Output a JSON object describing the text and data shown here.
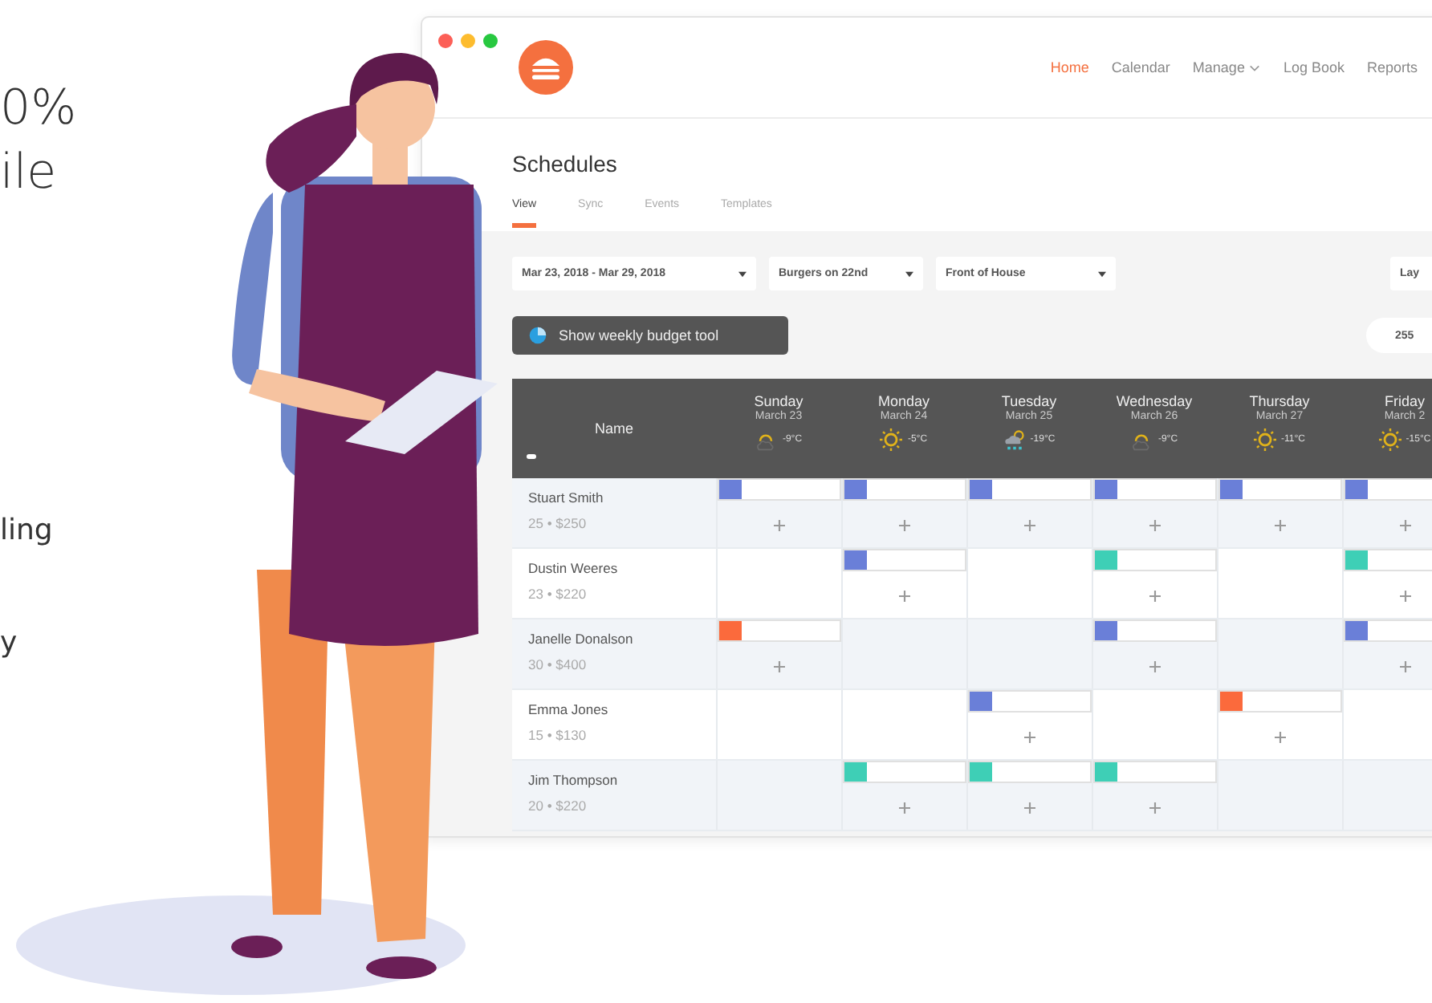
{
  "side_text": {
    "headline": [
      "0%",
      "ile"
    ],
    "body": [
      "ling",
      "y"
    ]
  },
  "window": {
    "nav": [
      {
        "label": "Home",
        "selected": true,
        "dropdown": false
      },
      {
        "label": "Calendar",
        "selected": false,
        "dropdown": false
      },
      {
        "label": "Manage",
        "selected": false,
        "dropdown": true
      },
      {
        "label": "Log Book",
        "selected": false,
        "dropdown": false
      },
      {
        "label": "Reports",
        "selected": false,
        "dropdown": false
      }
    ]
  },
  "page": {
    "title": "Schedules",
    "tabs": [
      {
        "label": "View",
        "selected": true
      },
      {
        "label": "Sync",
        "selected": false
      },
      {
        "label": "Events",
        "selected": false
      },
      {
        "label": "Templates",
        "selected": false
      }
    ]
  },
  "filters": [
    "Mar 23, 2018 - Mar 29, 2018",
    "Burgers on 22nd",
    "Front of House"
  ],
  "layout_button": "Lay",
  "budget_button": "Show weekly budget tool",
  "hours_pill": "255",
  "table": {
    "name_header": "Name",
    "days": [
      {
        "name": "Sunday",
        "date": "March 23",
        "kind": "cloud",
        "temp": "-9°C"
      },
      {
        "name": "Monday",
        "date": "March 24",
        "kind": "sun",
        "temp": "-5°C"
      },
      {
        "name": "Tuesday",
        "date": "March 25",
        "kind": "rain",
        "temp": "-19°C"
      },
      {
        "name": "Wednesday",
        "date": "March 26",
        "kind": "cloud",
        "temp": "-9°C"
      },
      {
        "name": "Thursday",
        "date": "March 27",
        "kind": "sun",
        "temp": "-11°C"
      },
      {
        "name": "Friday",
        "date": "March 2",
        "kind": "sun",
        "temp": "-15°C"
      }
    ],
    "rows": [
      {
        "name": "Stuart Smith",
        "meta": "25 • $250",
        "shifts": [
          {
            "filled": true,
            "color": "#6a7fd8"
          },
          {
            "filled": true,
            "color": "#6a7fd8"
          },
          {
            "filled": true,
            "color": "#6a7fd8"
          },
          {
            "filled": true,
            "color": "#6a7fd8"
          },
          {
            "filled": true,
            "color": "#6a7fd8"
          },
          {
            "filled": true,
            "color": "#6a7fd8"
          }
        ]
      },
      {
        "name": "Dustin Weeres",
        "meta": "23 • $220",
        "shifts": [
          {
            "filled": false
          },
          {
            "filled": true,
            "color": "#6a7fd8"
          },
          {
            "filled": false
          },
          {
            "filled": true,
            "color": "#3ecfb6"
          },
          {
            "filled": false
          },
          {
            "filled": true,
            "color": "#3ecfb6"
          }
        ]
      },
      {
        "name": "Janelle Donalson",
        "meta": "30 • $400",
        "shifts": [
          {
            "filled": true,
            "color": "#fb6a3c"
          },
          {
            "filled": false
          },
          {
            "filled": false
          },
          {
            "filled": true,
            "color": "#6a7fd8"
          },
          {
            "filled": false
          },
          {
            "filled": true,
            "color": "#6a7fd8"
          }
        ]
      },
      {
        "name": "Emma Jones",
        "meta": "15 • $130",
        "shifts": [
          {
            "filled": false
          },
          {
            "filled": false
          },
          {
            "filled": true,
            "color": "#6a7fd8"
          },
          {
            "filled": false
          },
          {
            "filled": true,
            "color": "#fb6a3c"
          },
          {
            "filled": false
          }
        ]
      },
      {
        "name": "Jim Thompson",
        "meta": "20 • $220",
        "shifts": [
          {
            "filled": false
          },
          {
            "filled": true,
            "color": "#3ecfb6"
          },
          {
            "filled": true,
            "color": "#3ecfb6"
          },
          {
            "filled": true,
            "color": "#3ecfb6"
          },
          {
            "filled": false
          },
          {
            "filled": false
          }
        ]
      }
    ]
  }
}
